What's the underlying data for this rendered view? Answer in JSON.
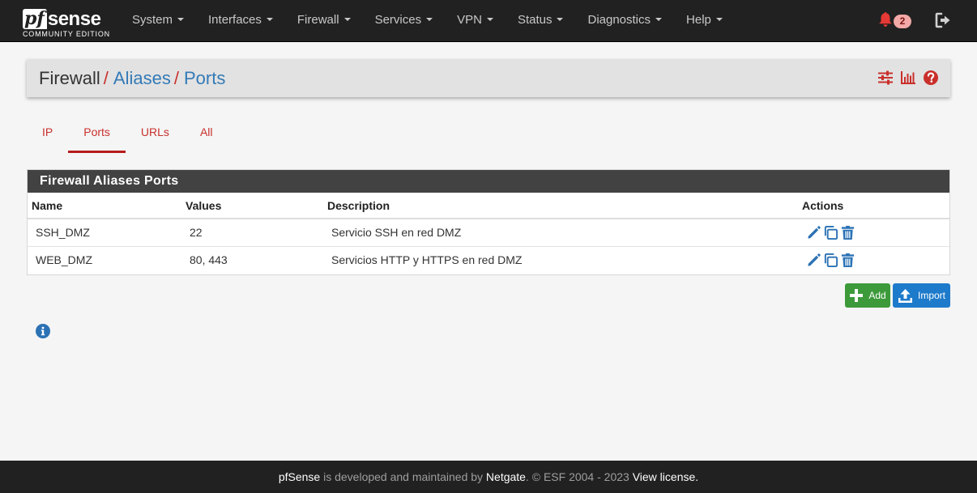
{
  "brand": {
    "logo_prefix": "pf",
    "logo_suffix": "sense",
    "edition": "COMMUNITY EDITION"
  },
  "nav": {
    "items": [
      {
        "label": "System"
      },
      {
        "label": "Interfaces"
      },
      {
        "label": "Firewall"
      },
      {
        "label": "Services"
      },
      {
        "label": "VPN"
      },
      {
        "label": "Status"
      },
      {
        "label": "Diagnostics"
      },
      {
        "label": "Help"
      }
    ],
    "notification_count": "2",
    "icons": {
      "notifications": "bell-icon",
      "logout": "logout-icon"
    }
  },
  "breadcrumb": {
    "items": [
      "Firewall",
      "Aliases",
      "Ports"
    ],
    "separator": "/"
  },
  "header_icons": [
    "sliders-icon",
    "bar-chart-icon",
    "help-circle-icon"
  ],
  "tabs": {
    "items": [
      {
        "label": "IP",
        "active": false
      },
      {
        "label": "Ports",
        "active": true
      },
      {
        "label": "URLs",
        "active": false
      },
      {
        "label": "All",
        "active": false
      }
    ]
  },
  "panel": {
    "title": "Firewall Aliases Ports",
    "columns": [
      "Name",
      "Values",
      "Description",
      "Actions"
    ],
    "rows": [
      {
        "name": "SSH_DMZ",
        "values": "22",
        "description": "Servicio SSH en red DMZ"
      },
      {
        "name": "WEB_DMZ",
        "values": "80, 443",
        "description": "Servicios HTTP y HTTPS en red DMZ"
      }
    ],
    "row_actions": [
      "pencil-icon",
      "copy-icon",
      "trash-icon"
    ]
  },
  "buttons": {
    "add": "Add",
    "import": "Import"
  },
  "colors": {
    "navbar": "#212121",
    "accent_red": "#c9302c",
    "link_blue": "#337ab7",
    "add_green": "#3c9a3a",
    "import_blue": "#1e7bcb",
    "panel_heading": "#424242"
  },
  "footer": {
    "product": "pfSense",
    "text_1": " is developed and maintained by ",
    "company": "Netgate",
    "text_2": ". © ESF 2004 - 2023 ",
    "license_link": "View license."
  }
}
